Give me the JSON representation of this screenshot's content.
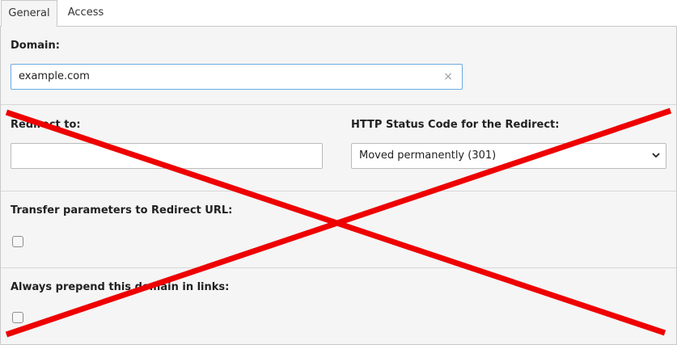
{
  "tabs": [
    {
      "label": "General",
      "active": true
    },
    {
      "label": "Access",
      "active": false
    }
  ],
  "domain": {
    "label": "Domain:",
    "value": "example.com",
    "clear_glyph": "×"
  },
  "redirect": {
    "label": "Redirect to:",
    "value": ""
  },
  "status_code": {
    "label": "HTTP Status Code for the Redirect:",
    "selected": "Moved permanently (301)"
  },
  "transfer_params": {
    "label": "Transfer parameters to Redirect URL:",
    "checked": false
  },
  "prepend_domain": {
    "label": "Always prepend this domain in links:",
    "checked": false
  },
  "overlay": {
    "icon": "red-x-cross-icon",
    "color": "#ee0000"
  },
  "colors": {
    "focus_border": "#6daae0",
    "panel_bg": "#f5f5f5"
  }
}
